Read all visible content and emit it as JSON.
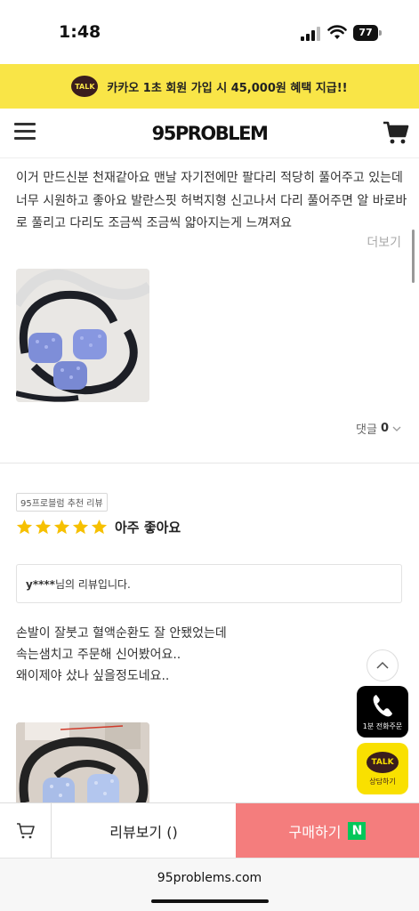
{
  "status": {
    "time": "1:48",
    "battery": "77"
  },
  "promo": {
    "talk_badge": "TALK",
    "text": "카카오 1초 회원 가입 시 45,000원 혜택 지급!!"
  },
  "header": {
    "logo": "95PROBLEM"
  },
  "review1": {
    "text": "이거 만드신분 천재같아요 맨날 자기전에만 팔다리 적당히 풀어주고 있는데 너무 시원하고 좋아요 발란스핏 허벅지형 신고나서 다리 풀어주면 알 바로바로 풀리고 다리도 조금씩 조금씩 얇아지는게 느껴져요",
    "more": "더보기",
    "comments_label": "댓글",
    "comments_count": "0"
  },
  "review2": {
    "badge": "95프로블럼 추천 리뷰",
    "rating": 5,
    "rating_label": "아주 좋아요",
    "reviewer_id": "y****",
    "reviewer_suffix": "님의 리뷰입니다.",
    "lines": [
      "손발이 잘붓고 혈액순환도 잘 안됐었는데",
      "속는샘치고 주문해 신어봤어요..",
      "왜이제야 샀나 싶을정도네요.."
    ]
  },
  "floating": {
    "call_label": "1분 전화주문",
    "kakao_badge": "TALK",
    "kakao_label": "상담하기"
  },
  "bottom_bar": {
    "review_view": "리뷰보기 ()",
    "buy": "구매하기",
    "naver": "N"
  },
  "browser": {
    "url": "95problems.com"
  },
  "colors": {
    "promo_bg": "#f9e547",
    "buy_bg": "#f47d7d",
    "naver_green": "#03c75a",
    "star": "#f6c000"
  }
}
